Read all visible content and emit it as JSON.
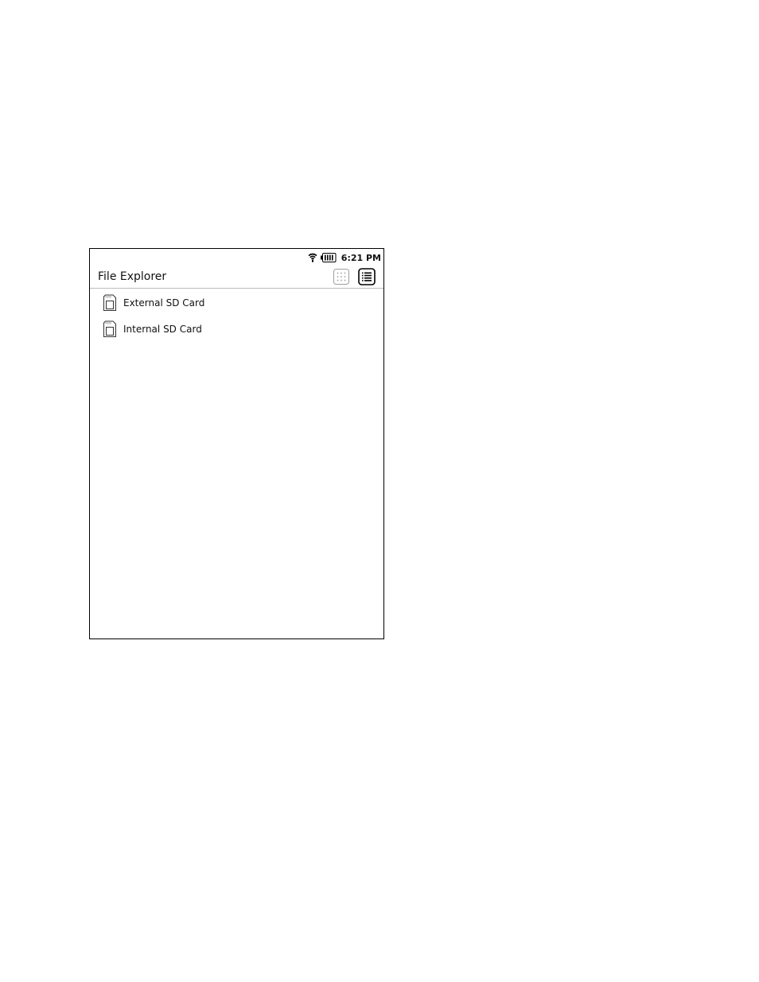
{
  "status_bar": {
    "time": "6:21 PM",
    "icons": [
      "wifi-icon",
      "battery-icon"
    ]
  },
  "header": {
    "title": "File Explorer",
    "view_toggles": [
      "grid-view-icon",
      "list-view-icon"
    ],
    "active_view": "list"
  },
  "file_list": {
    "items": [
      {
        "label": "External SD Card",
        "icon": "sd-card-icon"
      },
      {
        "label": "Internal SD Card",
        "icon": "sd-card-icon"
      }
    ]
  }
}
